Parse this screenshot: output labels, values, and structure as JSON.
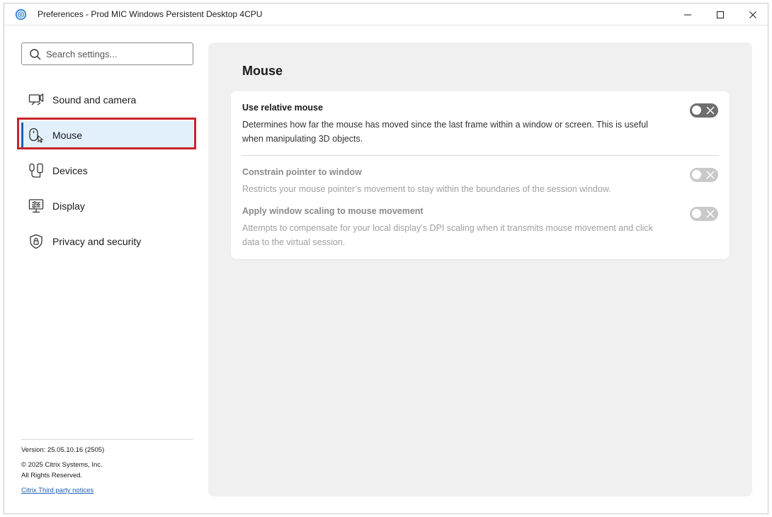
{
  "window": {
    "title": "Preferences - Prod MIC Windows Persistent Desktop 4CPU",
    "controls": [
      "minimize-icon",
      "maximize-icon",
      "close-icon"
    ]
  },
  "sidebar": {
    "search": {
      "placeholder": "Search settings...",
      "value": ""
    },
    "items": [
      {
        "label": "Sound and camera",
        "icon": "camera-speaker-icon",
        "active": false
      },
      {
        "label": "Mouse",
        "icon": "mouse-icon",
        "active": true
      },
      {
        "label": "Devices",
        "icon": "devices-icon",
        "active": false
      },
      {
        "label": "Display",
        "icon": "display-icon",
        "active": false
      },
      {
        "label": "Privacy and security",
        "icon": "shield-lock-icon",
        "active": false
      }
    ],
    "footer": {
      "version": "Version: 25.05.10.16 (2505)",
      "copyright": "© 2025 Citrix Systems, Inc.",
      "rights": "All Rights Reserved.",
      "link": "Citrix Third party notices"
    }
  },
  "main": {
    "title": "Mouse",
    "settings": [
      {
        "title": "Use relative mouse",
        "description": "Determines how far the mouse has moved since the last frame within a window or screen. This is useful when manipulating 3D objects.",
        "enabled": false,
        "disabled": false
      },
      {
        "title": "Constrain pointer to window",
        "description": "Restricts your mouse pointer’s movement to stay within the boundaries of the session window.",
        "enabled": false,
        "disabled": true
      },
      {
        "title": "Apply window scaling to mouse movement",
        "description": "Attempts to compensate for your local display’s DPI scaling when it transmits mouse movement and click data to the virtual session.",
        "enabled": false,
        "disabled": true
      }
    ]
  },
  "colors": {
    "accent": "#1f5fb8",
    "active_bg": "#e1f0fb",
    "highlight": "#c8232c",
    "panel_bg": "#f0f0f0"
  }
}
